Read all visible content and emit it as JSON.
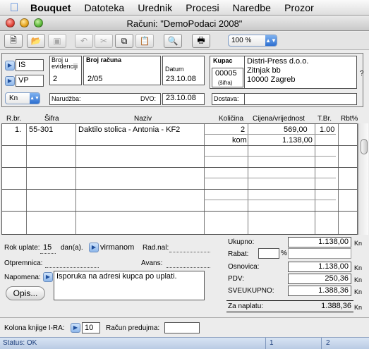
{
  "menubar": {
    "app": "Bouquet",
    "items": [
      "Datoteka",
      "Urednik",
      "Procesi",
      "Naredbe",
      "Prozor"
    ]
  },
  "window": {
    "title": "Računi: \"DemoPodaci 2008\""
  },
  "toolbar": {
    "zoom": "100 %"
  },
  "header": {
    "doc_type_1": "IS",
    "doc_type_2": "VP",
    "currency": "Kn",
    "broj_u_evidenciji_label": "Broj u evidenciji",
    "broj_u_evidenciji": "2",
    "broj_racuna_label": "Broj računa",
    "broj_racuna": "2/05",
    "datum_label": "Datum",
    "datum": "23.10.08",
    "narudzba_label": "Narudžba:",
    "narudzba": "",
    "dvo_label": "DVO:",
    "dvo": "23.10.08",
    "dostava_label": "Dostava:",
    "dostava": ""
  },
  "customer": {
    "label": "Kupac",
    "code": "00005",
    "code_sub": "(šifra)",
    "name": "Distri-Press d.o.o.",
    "street": "Zitnjak bb",
    "city": "10000 Zagreb"
  },
  "table": {
    "columns": [
      "R.br.",
      "Šifra",
      "Naziv",
      "Količina",
      "Cijena/vrijednost",
      "T.Br.",
      "Rbt%"
    ],
    "rows": [
      {
        "rbr": "1.",
        "sifra": "55-301",
        "naziv": "Daktilo stolica - Antonia - KF2",
        "kolicina": "2",
        "jm": "kom",
        "cijena": "569,00",
        "vrijednost": "1.138,00",
        "tbr": "1.00",
        "rbt": ""
      }
    ]
  },
  "footer": {
    "rok_uplate_label": "Rok uplate:",
    "rok_uplate": "15",
    "dana_label": "dan(a).",
    "virmanom": "virmanom",
    "rad_nal_label": "Rad.nal:",
    "otpremnica_label": "Otpremnica:",
    "avans_label": "Avans:",
    "napomena_label": "Napomena:",
    "napomena": "Isporuka na adresi kupca po uplati.",
    "opis_button": "Opis...",
    "kolona_label": "Kolona knjige I-RA:",
    "kolona": "10",
    "racun_predujma_label": "Račun predujma:",
    "racun_predujma": ""
  },
  "summary": {
    "ukupno_label": "Ukupno:",
    "ukupno": "1.138,00",
    "rabat_label": "Rabat:",
    "rabat": "",
    "percent": "%",
    "osnovica_label": "Osnovica:",
    "osnovica": "1.138,00",
    "pdv_label": "PDV:",
    "pdv": "250,36",
    "sveukupno_label": "SVEUKUPNO:",
    "sveukupno": "1.388,36",
    "za_naplatu_label": "Za naplatu:",
    "za_naplatu": "1.388,36",
    "currency": "Kn"
  },
  "status": {
    "text": "Status: OK",
    "seg1": "1",
    "seg2": "2"
  }
}
